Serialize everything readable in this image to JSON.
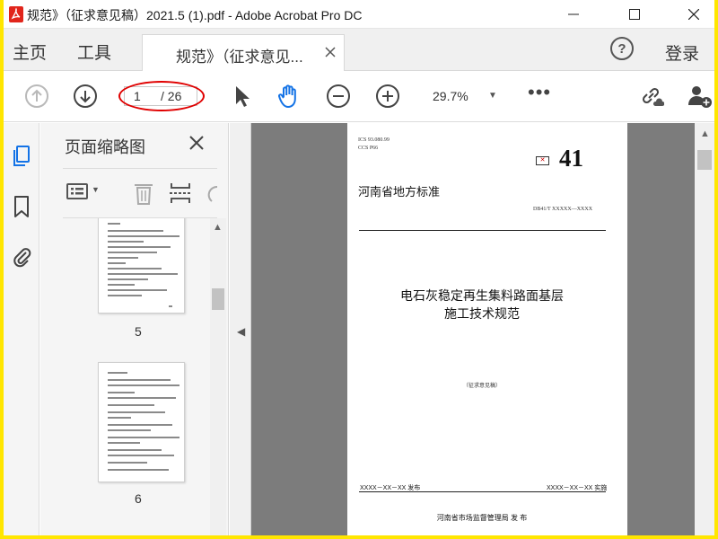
{
  "window": {
    "title": "规范》（征求意见稿）2021.5 (1).pdf - Adobe Acrobat Pro DC"
  },
  "menu": {
    "home_label": "主页",
    "tools_label": "工具",
    "document_tab_label": "规范》（征求意见...",
    "help_label": "?",
    "login_label": "登录"
  },
  "toolbar": {
    "current_page": "1",
    "total_pages": "/ 26",
    "zoom": "29.7%",
    "more_label": "•••"
  },
  "thumbnail_panel": {
    "title": "页面缩略图",
    "pages": [
      {
        "number": "5"
      },
      {
        "number": "6"
      }
    ]
  },
  "document_page": {
    "ics_lines": [
      "ICS  93.080.99",
      "CCS  P66"
    ],
    "standard_number": "41",
    "organization": "河南省地方标准",
    "standard_code": "DB41/T XXXXX—XXXX",
    "title_line1": "电石灰稳定再生集料路面基层",
    "title_line2": "施工技术规范",
    "draft_note": "（征求意见稿）",
    "issue_date": "XXXX－XX－XX 发布",
    "implement_date": "XXXX－XX－XX 实施",
    "publisher": "河南省市场监督管理局    发 布"
  },
  "colors": {
    "border_highlight": "#ffe600",
    "annotation_red": "#e00000",
    "active_blue": "#1473e6",
    "doc_background": "#7c7c7c"
  }
}
